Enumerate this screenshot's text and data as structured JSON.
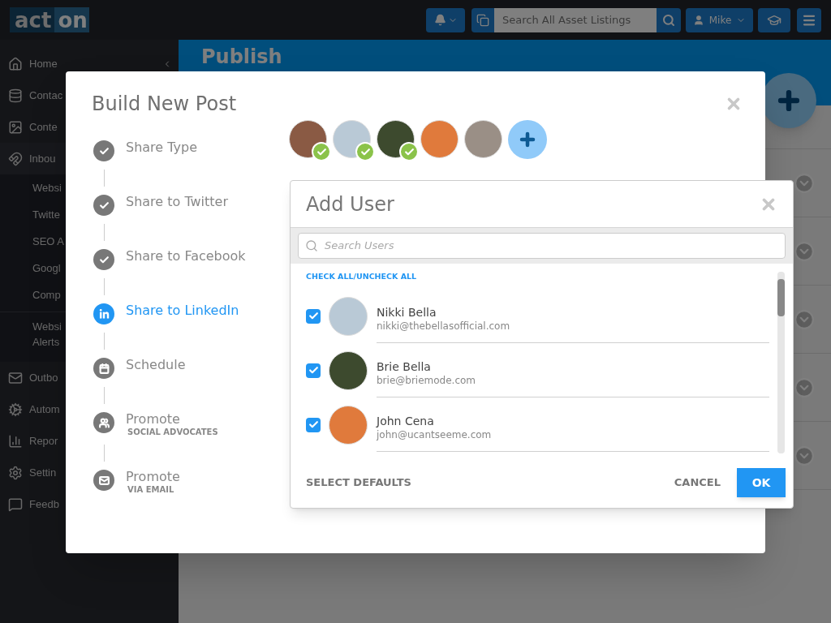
{
  "header": {
    "logo": [
      "act",
      "on"
    ],
    "search": {
      "placeholder": "Search All Asset Listings"
    },
    "user": "Mike"
  },
  "sidebar": {
    "items": [
      {
        "label": "Home"
      },
      {
        "label": "Contac"
      },
      {
        "label": "Conte"
      },
      {
        "label": "Inbou",
        "expanded": true,
        "children": [
          {
            "lines": [
              "Websi"
            ]
          },
          {
            "lines": [
              "Twitte"
            ]
          },
          {
            "lines": [
              "SEO A"
            ]
          },
          {
            "lines": [
              "Googl"
            ]
          },
          {
            "lines": [
              "Comp"
            ]
          },
          {
            "lines": [
              "Websi",
              "Alerts"
            ],
            "divided": true
          }
        ]
      },
      {
        "label": "Outbo"
      },
      {
        "label": "Autom"
      },
      {
        "label": "Repor"
      },
      {
        "label": "Settin"
      },
      {
        "label": "Feedb"
      }
    ]
  },
  "page": {
    "title": "Publish"
  },
  "modal": {
    "title": "Build New Post",
    "steps": [
      {
        "label": "Share Type",
        "completed": true,
        "selected": false
      },
      {
        "label": "Share to Twitter",
        "completed": true,
        "selected": false
      },
      {
        "label": "Share to Facebook",
        "completed": true,
        "selected": false
      },
      {
        "label": "Share to LinkedIn",
        "completed": false,
        "selected": true
      },
      {
        "label": "Schedule",
        "completed": false,
        "selected": false
      },
      {
        "label": "Promote",
        "sublabel": "SOCIAL ADVOCATES",
        "completed": false,
        "selected": false
      },
      {
        "label": "Promote",
        "sublabel": "VIA EMAIL",
        "completed": false,
        "selected": false
      }
    ],
    "selected_users": [
      {
        "checked": true
      },
      {
        "checked": true
      },
      {
        "checked": true
      },
      {
        "checked": false
      },
      {
        "checked": false
      }
    ]
  },
  "add_user": {
    "title": "Add User",
    "search": {
      "placeholder": "Search Users"
    },
    "check_all": "CHECK ALL/UNCHECK ALL",
    "users": [
      {
        "name": "Nikki Bella",
        "email": "nikki@thebellasofficial.com",
        "checked": true
      },
      {
        "name": "Brie Bella",
        "email": "brie@briemode.com",
        "checked": true
      },
      {
        "name": "John Cena",
        "email": "john@ucantseeme.com",
        "checked": true
      }
    ],
    "buttons": {
      "defaults": "SELECT DEFAULTS",
      "cancel": "CANCEL",
      "ok": "OK"
    }
  }
}
